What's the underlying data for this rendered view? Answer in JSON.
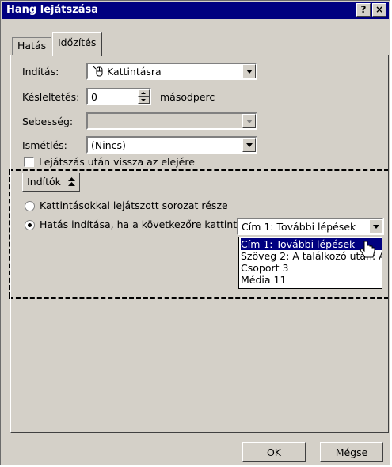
{
  "window": {
    "title": "Hang lejátszása",
    "help_label": "?",
    "close_label": "×"
  },
  "tabs": [
    {
      "label": "Hatás"
    },
    {
      "label": "Időzítés",
      "active": true
    }
  ],
  "form": {
    "start_label": "Indítás:",
    "start_value": "Kattintásra",
    "start_icon": "mouse-icon",
    "delay_label": "Késleltetés:",
    "delay_value": "0",
    "delay_unit": "másodperc",
    "speed_label": "Sebesség:",
    "speed_value": "",
    "repeat_label": "Ismétlés:",
    "repeat_value": "(Nincs)",
    "rewind_label": "Lejátszás után vissza az elejére",
    "rewind_checked": false
  },
  "triggers": {
    "button_label": "Indítók",
    "option1_label": "Kattintásokkal lejátszott sorozat része",
    "option2_label": "Hatás indítása, ha a következőre kattint:",
    "selected_option": 2,
    "combo_value": "Cím 1: További lépések",
    "list_items": [
      {
        "label": "Cím 1: További lépések",
        "selected": true
      },
      {
        "label": "Szöveg 2: A találkozó után: A"
      },
      {
        "label": "Csoport 3"
      },
      {
        "label": "Média 11"
      }
    ]
  },
  "buttons": {
    "ok_label": "OK",
    "cancel_label": "Mégse"
  }
}
